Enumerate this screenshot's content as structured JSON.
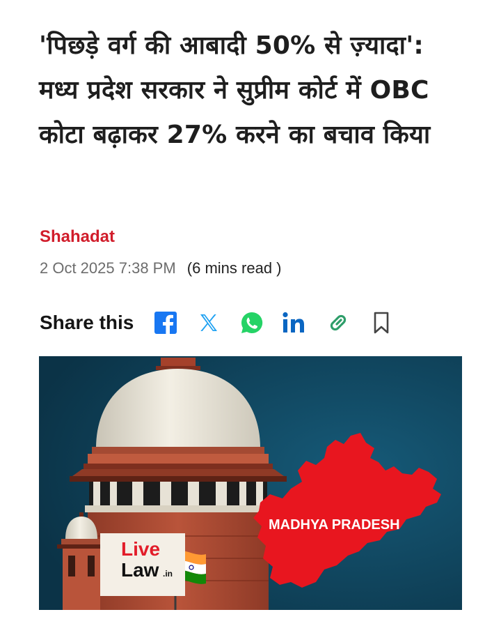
{
  "article": {
    "headline": "'पिछड़े वर्ग की आबादी 50% से ज़्यादा': मध्य प्रदेश सरकार ने सुप्रीम कोर्ट में OBC कोटा बढ़ाकर 27% करने का बचाव किया",
    "author": "Shahadat",
    "date": "2 Oct 2025 7:38 PM",
    "read_time": "(6 mins read )"
  },
  "share": {
    "label": "Share this",
    "buttons": [
      {
        "icon": "facebook-icon",
        "color": "#1877f2"
      },
      {
        "icon": "x-icon",
        "color": "#1da1f2"
      },
      {
        "icon": "whatsapp-icon",
        "color": "#25d366"
      },
      {
        "icon": "linkedin-icon",
        "color": "#0a66c2"
      },
      {
        "icon": "link-icon",
        "color": "#2e9e6a"
      },
      {
        "icon": "bookmark-icon",
        "color": "#444444"
      }
    ]
  },
  "hero_image": {
    "map_label": "MADHYA PRADESH",
    "logo_line1": "Live",
    "logo_line2": "Law",
    "logo_suffix": ".in",
    "colors": {
      "background": "#0f3f57",
      "map": "#e8161f",
      "building": "#b04a32"
    }
  }
}
